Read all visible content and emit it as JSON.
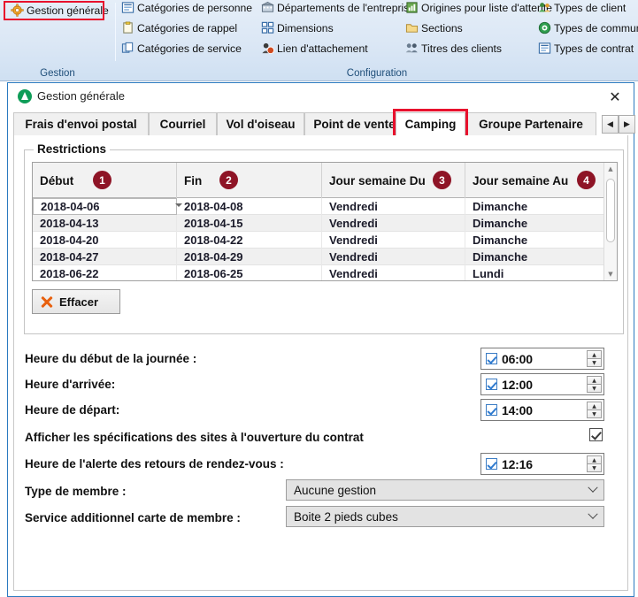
{
  "ribbon": {
    "groups": [
      {
        "label": "Gestion"
      },
      {
        "label": "Configuration"
      }
    ],
    "gestion_items": [
      {
        "label": "Gestion générale",
        "icon": "gear-icon"
      }
    ],
    "config_items": [
      {
        "label": "Catégories de personne",
        "icon": "list-icon"
      },
      {
        "label": "Catégories de rappel",
        "icon": "clipboard-icon"
      },
      {
        "label": "Catégories de service",
        "icon": "copy-icon"
      },
      {
        "label": "Départements de l'entreprise",
        "icon": "building-icon"
      },
      {
        "label": "Dimensions",
        "icon": "grid-icon"
      },
      {
        "label": "Lien d'attachement",
        "icon": "person-link-icon"
      },
      {
        "label": "Origines pour liste d'attente",
        "icon": "chart-person-icon"
      },
      {
        "label": "Sections",
        "icon": "folder-icon"
      },
      {
        "label": "Titres des clients",
        "icon": "people-icon"
      },
      {
        "label": "Types de client",
        "icon": "people-green-icon"
      },
      {
        "label": "Types de communi",
        "icon": "phone-circle-icon"
      },
      {
        "label": "Types de contrat",
        "icon": "document-icon"
      }
    ]
  },
  "dialog": {
    "title": "Gestion générale",
    "icon": "app-green-icon",
    "close_label": "✕"
  },
  "tabs": {
    "items": [
      {
        "label": "Frais d'envoi postal",
        "active": false
      },
      {
        "label": "Courriel",
        "active": false
      },
      {
        "label": "Vol d'oiseau",
        "active": false
      },
      {
        "label": "Point de vente",
        "active": false
      },
      {
        "label": "Camping",
        "active": true
      },
      {
        "label": "Groupe Partenaire",
        "active": false
      }
    ],
    "nav_prev": "◀",
    "nav_next": "▶",
    "highlight_color": "#e8112d"
  },
  "restrictions": {
    "legend": "Restrictions",
    "badge_color": "#8e1426",
    "columns": [
      {
        "label": "Début",
        "badge": "1"
      },
      {
        "label": "Fin",
        "badge": "2"
      },
      {
        "label": "Jour semaine Du",
        "badge": "3"
      },
      {
        "label": "Jour semaine Au",
        "badge": "4"
      }
    ],
    "rows": [
      {
        "debut": "2018-04-06",
        "fin": "2018-04-08",
        "jour_du": "Vendredi",
        "jour_au": "Dimanche"
      },
      {
        "debut": "2018-04-13",
        "fin": "2018-04-15",
        "jour_du": "Vendredi",
        "jour_au": "Dimanche"
      },
      {
        "debut": "2018-04-20",
        "fin": "2018-04-22",
        "jour_du": "Vendredi",
        "jour_au": "Dimanche"
      },
      {
        "debut": "2018-04-27",
        "fin": "2018-04-29",
        "jour_du": "Vendredi",
        "jour_au": "Dimanche"
      },
      {
        "debut": "2018-06-22",
        "fin": "2018-06-25",
        "jour_du": "Vendredi",
        "jour_au": "Lundi"
      }
    ],
    "clear_button": "Effacer"
  },
  "form": {
    "heure_debut_journee": {
      "label": "Heure du début de la journée :",
      "value": "06:00",
      "checked": true
    },
    "heure_arrivee": {
      "label": "Heure d'arrivée:",
      "value": "12:00",
      "checked": true
    },
    "heure_depart": {
      "label": "Heure de départ:",
      "value": "14:00",
      "checked": true
    },
    "afficher_specifications": {
      "label": "Afficher les spécifications des sites à l'ouverture du contrat",
      "checked": true
    },
    "heure_alerte": {
      "label": "Heure de l'alerte des retours de rendez-vous :",
      "value": "12:16",
      "checked": true
    },
    "type_membre": {
      "label": "Type de membre :",
      "value": "Aucune gestion"
    },
    "service_additionnel": {
      "label": "Service additionnel carte de membre :",
      "value": "Boite 2 pieds cubes"
    }
  }
}
